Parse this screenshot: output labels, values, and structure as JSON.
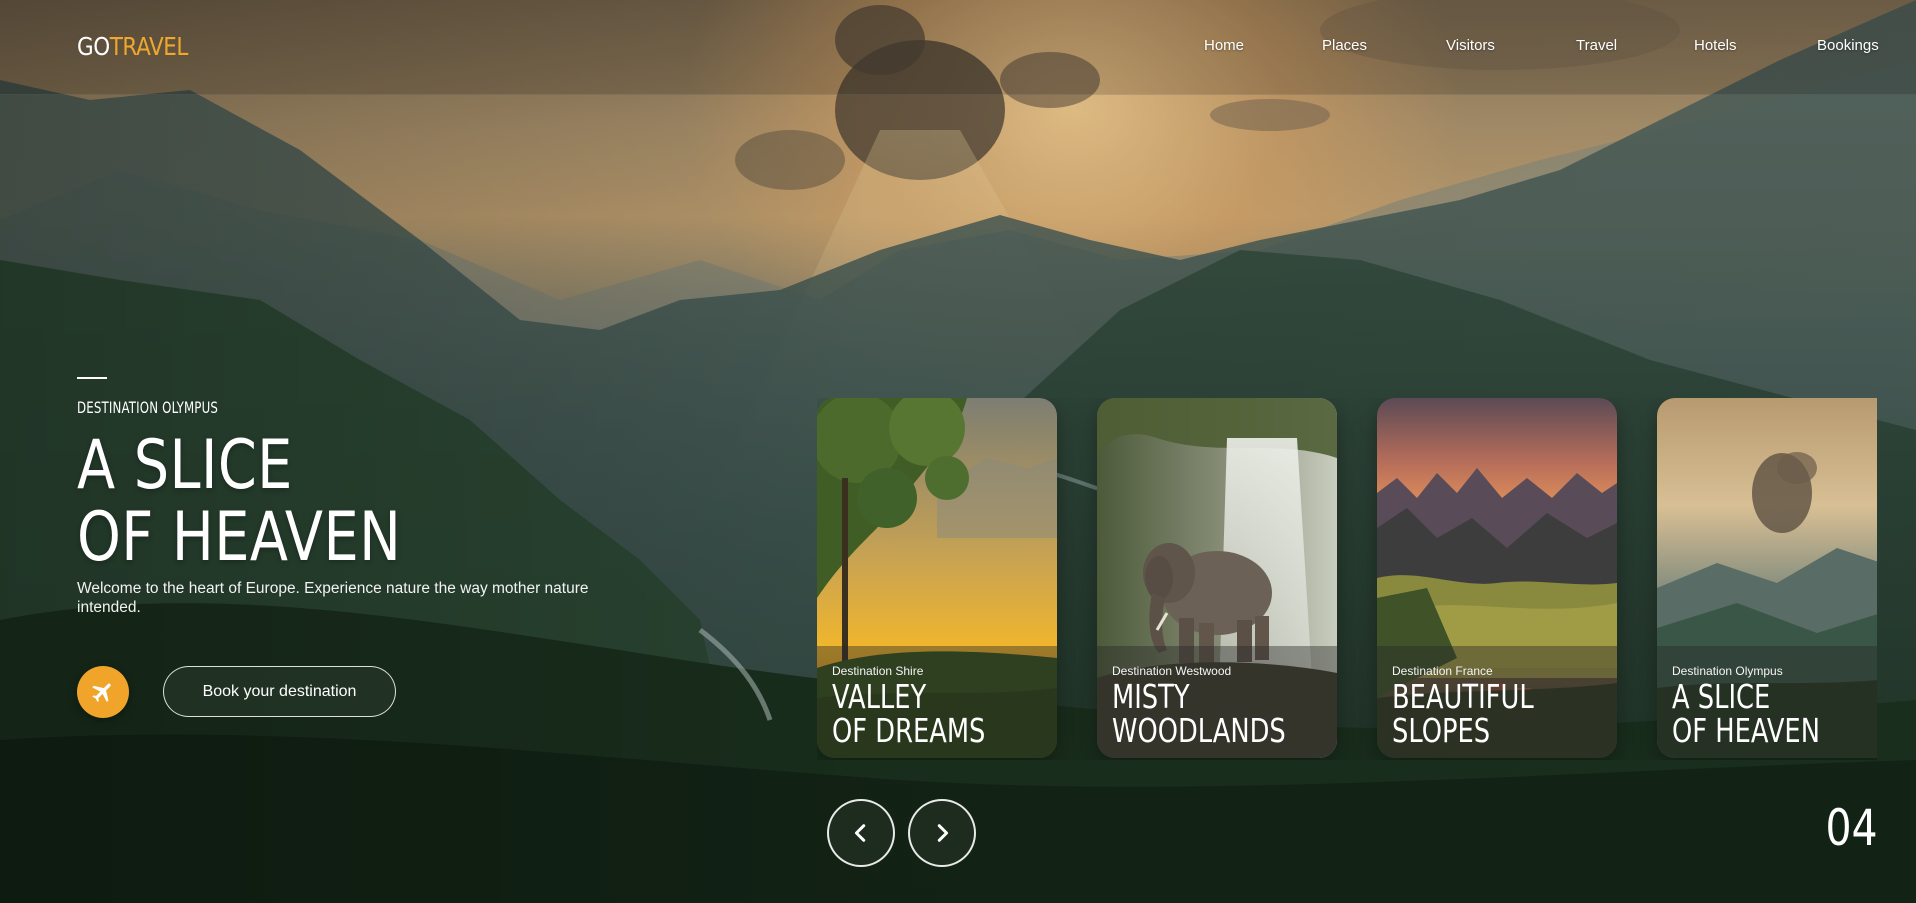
{
  "brand": {
    "go": "GO",
    "travel": "TRAVEL",
    "accent_color": "#f0a82c"
  },
  "nav": {
    "items": [
      {
        "label": "Home"
      },
      {
        "label": "Places"
      },
      {
        "label": "Visitors"
      },
      {
        "label": "Travel"
      },
      {
        "label": "Hotels"
      },
      {
        "label": "Bookings"
      }
    ]
  },
  "hero": {
    "eyebrow": "DESTINATION OLYMPUS",
    "title_line1": "A SLICE",
    "title_line2": "OF HEAVEN",
    "description": "Welcome to the heart of Europe. Experience nature the way mother nature intended.",
    "cta_icon": "airplane-icon",
    "cta_color": "#f0a52a",
    "book_label": "Book your destination"
  },
  "cards": [
    {
      "subtitle": "Destination Shire",
      "line1": "VALLEY",
      "line2": "OF DREAMS"
    },
    {
      "subtitle": "Destination Westwood",
      "line1": "MISTY",
      "line2": "WOODLANDS"
    },
    {
      "subtitle": "Destination France",
      "line1": "BEAUTIFUL",
      "line2": "SLOPES"
    },
    {
      "subtitle": "Destination Olympus",
      "line1": "A SLICE",
      "line2": "OF HEAVEN"
    }
  ],
  "slider": {
    "prev_icon": "chevron-left-icon",
    "next_icon": "chevron-right-icon",
    "counter": "04"
  }
}
